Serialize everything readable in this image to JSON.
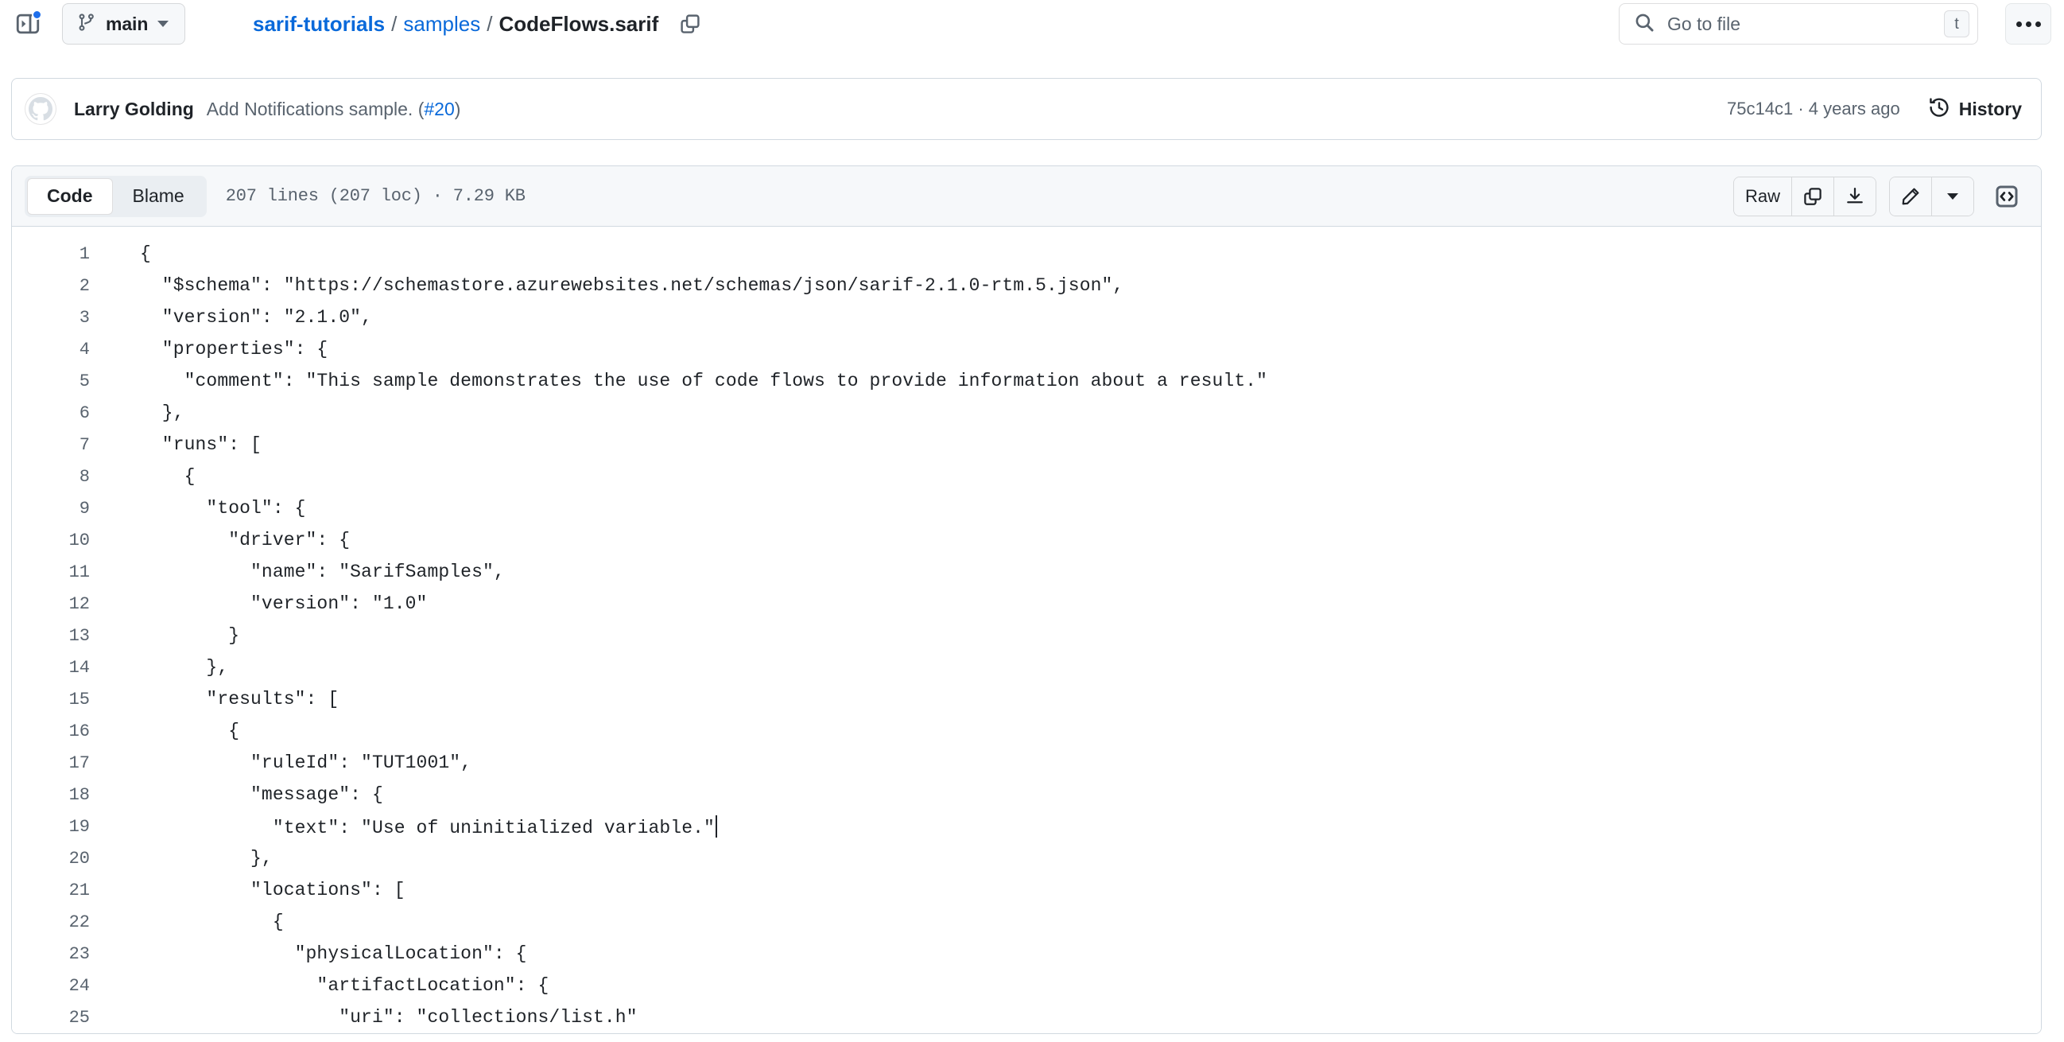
{
  "topbar": {
    "panel_toggle_icon": "sidebar-expand-icon",
    "notification_dot_color": "#1f6feb",
    "branch": {
      "icon": "git-branch-icon",
      "name": "main",
      "caret": "chevron-down-icon"
    },
    "breadcrumb": {
      "repo": "sarif-tutorials",
      "sep1": "/",
      "folder": "samples",
      "sep2": "/",
      "file": "CodeFlows.sarif",
      "copy_icon": "copy-path-icon"
    },
    "search": {
      "icon": "search-icon",
      "placeholder": "Go to file",
      "shortcut": "t"
    },
    "more_icon": "kebab-horizontal-icon"
  },
  "commit": {
    "avatar_icon": "github-mark-avatar",
    "author": "Larry Golding",
    "message": "Add Notifications sample. (",
    "pr_number": "#20",
    "message_end": ")",
    "sha_and_time": "75c14c1 · 4 years ago",
    "history_icon": "history-clock-icon",
    "history_label": "History"
  },
  "file_header": {
    "tabs": [
      {
        "label": "Code",
        "active": true
      },
      {
        "label": "Blame",
        "active": false
      }
    ],
    "stats": "207 lines (207 loc) · 7.29 KB",
    "raw_label": "Raw",
    "copy_icon": "copy-raw-icon",
    "download_icon": "download-icon",
    "edit_icon": "pencil-edit-icon",
    "edit_caret_icon": "chevron-down-icon",
    "symbols_icon": "code-brackets-icon"
  },
  "code": {
    "language": "json",
    "lines": [
      {
        "n": "1",
        "text": "{"
      },
      {
        "n": "2",
        "text": "  \"$schema\": \"https://schemastore.azurewebsites.net/schemas/json/sarif-2.1.0-rtm.5.json\","
      },
      {
        "n": "3",
        "text": "  \"version\": \"2.1.0\","
      },
      {
        "n": "4",
        "text": "  \"properties\": {"
      },
      {
        "n": "5",
        "text": "    \"comment\": \"This sample demonstrates the use of code flows to provide information about a result.\""
      },
      {
        "n": "6",
        "text": "  },"
      },
      {
        "n": "7",
        "text": "  \"runs\": ["
      },
      {
        "n": "8",
        "text": "    {"
      },
      {
        "n": "9",
        "text": "      \"tool\": {"
      },
      {
        "n": "10",
        "text": "        \"driver\": {"
      },
      {
        "n": "11",
        "text": "          \"name\": \"SarifSamples\","
      },
      {
        "n": "12",
        "text": "          \"version\": \"1.0\""
      },
      {
        "n": "13",
        "text": "        }"
      },
      {
        "n": "14",
        "text": "      },"
      },
      {
        "n": "15",
        "text": "      \"results\": ["
      },
      {
        "n": "16",
        "text": "        {"
      },
      {
        "n": "17",
        "text": "          \"ruleId\": \"TUT1001\","
      },
      {
        "n": "18",
        "text": "          \"message\": {"
      },
      {
        "n": "19",
        "text": "            \"text\": \"Use of uninitialized variable.\"",
        "caret": true
      },
      {
        "n": "20",
        "text": "          },"
      },
      {
        "n": "21",
        "text": "          \"locations\": ["
      },
      {
        "n": "22",
        "text": "            {"
      },
      {
        "n": "23",
        "text": "              \"physicalLocation\": {"
      },
      {
        "n": "24",
        "text": "                \"artifactLocation\": {"
      },
      {
        "n": "25",
        "text": "                  \"uri\": \"collections/list.h\""
      }
    ]
  },
  "colors": {
    "link": "#0969da",
    "muted": "#59636e",
    "text": "#1f2328",
    "border": "#d1d9e0",
    "header_bg": "#f6f8fa"
  }
}
